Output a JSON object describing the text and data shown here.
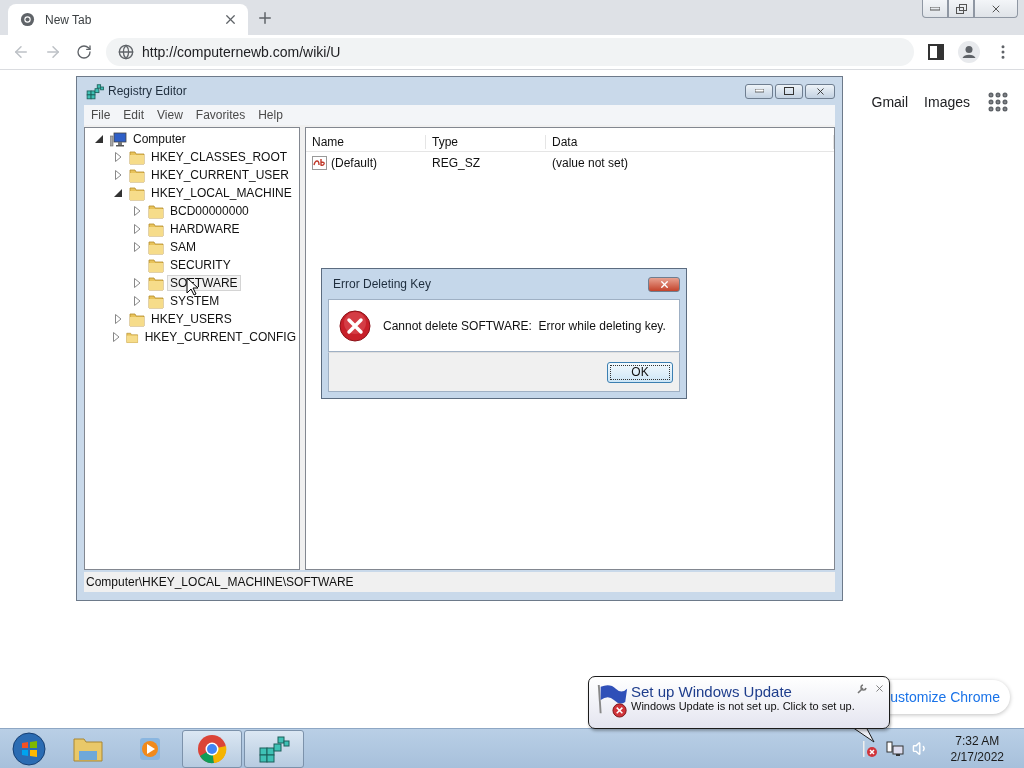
{
  "browser": {
    "tabs": [
      {
        "title": "New Tab",
        "selected": true
      }
    ],
    "url": "http://computernewb.com/wiki/U",
    "page_links": [
      "Gmail",
      "Images"
    ],
    "customize_button": "ustomize Chrome"
  },
  "regedit": {
    "title": "Registry Editor",
    "menu": [
      "File",
      "Edit",
      "View",
      "Favorites",
      "Help"
    ],
    "tree": [
      {
        "label": "Computer",
        "kind": "computer",
        "expandable": true,
        "expanded": true,
        "selected": false,
        "children": [
          {
            "label": "HKEY_CLASSES_ROOT",
            "kind": "folder",
            "expandable": true,
            "expanded": false,
            "selected": false
          },
          {
            "label": "HKEY_CURRENT_USER",
            "kind": "folder",
            "expandable": true,
            "expanded": false,
            "selected": false
          },
          {
            "label": "HKEY_LOCAL_MACHINE",
            "kind": "folder",
            "expandable": true,
            "expanded": true,
            "selected": false,
            "children": [
              {
                "label": "BCD00000000",
                "kind": "folder",
                "expandable": true,
                "expanded": false,
                "selected": false
              },
              {
                "label": "HARDWARE",
                "kind": "folder",
                "expandable": true,
                "expanded": false,
                "selected": false
              },
              {
                "label": "SAM",
                "kind": "folder",
                "expandable": true,
                "expanded": false,
                "selected": false
              },
              {
                "label": "SECURITY",
                "kind": "folder",
                "expandable": false,
                "expanded": false,
                "selected": false
              },
              {
                "label": "SOFTWARE",
                "kind": "folder",
                "expandable": true,
                "expanded": false,
                "selected": true
              },
              {
                "label": "SYSTEM",
                "kind": "folder",
                "expandable": true,
                "expanded": false,
                "selected": false
              }
            ]
          },
          {
            "label": "HKEY_USERS",
            "kind": "folder",
            "expandable": true,
            "expanded": false,
            "selected": false
          },
          {
            "label": "HKEY_CURRENT_CONFIG",
            "kind": "folder",
            "expandable": true,
            "expanded": false,
            "selected": false
          }
        ]
      }
    ],
    "columns": [
      "Name",
      "Type",
      "Data"
    ],
    "rows": [
      {
        "name": "(Default)",
        "type": "REG_SZ",
        "data": "(value not set)"
      }
    ],
    "status": "Computer\\HKEY_LOCAL_MACHINE\\SOFTWARE"
  },
  "dialog": {
    "title": "Error Deleting Key",
    "message": "Cannot delete SOFTWARE:  Error while deleting key.",
    "buttons": [
      "OK"
    ]
  },
  "balloon": {
    "title": "Set up Windows Update",
    "text": "Windows Update is not set up. Click to set up."
  },
  "taskbar": {
    "apps": [
      {
        "kind": "explorer",
        "active": false
      },
      {
        "kind": "media",
        "active": false
      },
      {
        "kind": "chrome",
        "active": true
      },
      {
        "kind": "regedit",
        "active": true
      }
    ],
    "time": "7:32 AM",
    "date": "2/17/2022"
  }
}
